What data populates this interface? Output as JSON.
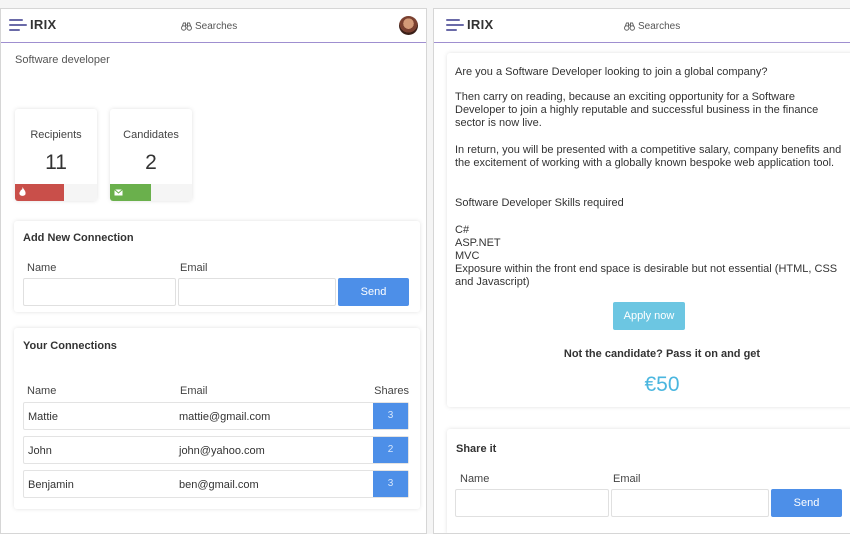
{
  "app": {
    "logo": "IRIX",
    "searches_label": "Searches"
  },
  "left": {
    "page_title": "Software developer",
    "stats": [
      {
        "label": "Recipients",
        "value": "11",
        "progress": 0.6,
        "color": "#c94f4a",
        "icon": "flame-icon"
      },
      {
        "label": "Candidates",
        "value": "2",
        "progress": 0.5,
        "color": "#6ab04c",
        "icon": "mail-icon"
      }
    ],
    "add_connection": {
      "title": "Add New Connection",
      "name_label": "Name",
      "email_label": "Email",
      "name_value": "",
      "email_value": "",
      "send_label": "Send"
    },
    "connections": {
      "title": "Your Connections",
      "headers": {
        "name": "Name",
        "email": "Email",
        "shares": "Shares"
      },
      "rows": [
        {
          "name": "Mattie",
          "email": "mattie@gmail.com",
          "shares": "3"
        },
        {
          "name": "John",
          "email": "john@yahoo.com",
          "shares": "2"
        },
        {
          "name": "Benjamin",
          "email": "ben@gmail.com",
          "shares": "3"
        }
      ]
    }
  },
  "right": {
    "paragraphs": [
      "Are you a Software Developer looking to join a global company?",
      "Then carry on reading, because an exciting opportunity for a Software Developer to join a highly reputable and successful business in the finance sector is now live.",
      "In return, you will be presented with a competitive salary, company benefits and the excitement of working with a globally known bespoke web application tool.",
      "Software Developer Skills required"
    ],
    "skills": [
      "C#",
      "ASP.NET",
      "MVC",
      "Exposure within the front end space is desirable but not essential (HTML, CSS and Javascript)"
    ],
    "apply_label": "Apply now",
    "pass_on_text": "Not the candidate? Pass it on and get",
    "reward": "€50",
    "share": {
      "title": "Share it",
      "name_label": "Name",
      "email_label": "Email",
      "name_value": "",
      "email_value": "",
      "send_label": "Send"
    }
  },
  "colors": {
    "accent": "#4d8fe8",
    "apply": "#6cc6e2",
    "reward": "#4ab6df",
    "header_line": "#9f8fd0"
  }
}
